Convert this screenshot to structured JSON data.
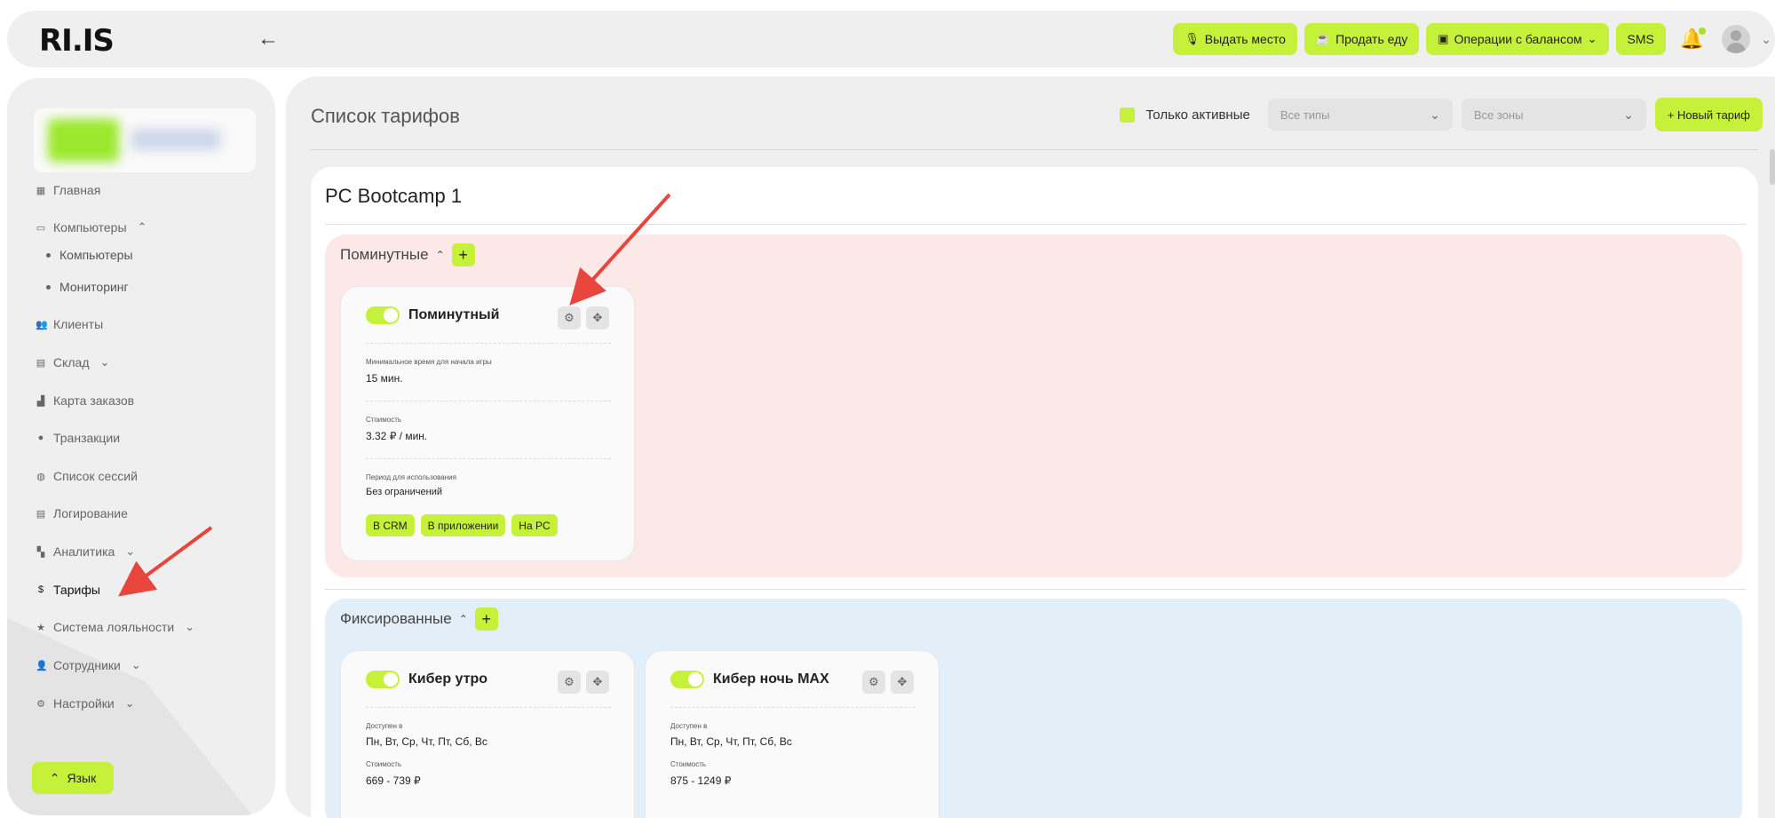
{
  "topbar": {
    "logo": "RI.IS",
    "actions": {
      "give_seat": "Выдать место",
      "sell_food": "Продать еду",
      "balance_ops": "Операции с балансом",
      "sms": "SMS"
    }
  },
  "sidebar": {
    "items": {
      "home": "Главная",
      "computers": "Компьютеры",
      "computers_sub": "Компьютеры",
      "monitoring": "Мониторинг",
      "clients": "Клиенты",
      "warehouse": "Склад",
      "orders_map": "Карта заказов",
      "transactions": "Транзакции",
      "sessions": "Список сессий",
      "logging": "Логирование",
      "analytics": "Аналитика",
      "tariffs": "Тарифы",
      "loyalty": "Система лояльности",
      "employees": "Сотрудники",
      "settings": "Настройки"
    },
    "language_button": "Язык"
  },
  "main": {
    "title": "Список тарифов",
    "only_active_label": "Только активные",
    "type_select_placeholder": "Все типы",
    "zone_select_placeholder": "Все зоны",
    "new_tariff_button": "+ Новый тариф"
  },
  "zone": {
    "name": "PC Bootcamp 1",
    "groups": {
      "per_minute": {
        "label": "Поминутные",
        "card": {
          "name": "Поминутный",
          "min_time_label": "Минимальное время для начала игры",
          "min_time_value": "15 мин.",
          "cost_label": "Стоимость",
          "cost_value": "3.32 ₽ / мин.",
          "period_label": "Период для использования",
          "period_value": "Без ограничений",
          "badges": [
            "В CRM",
            "В приложении",
            "На PC"
          ]
        }
      },
      "fixed": {
        "label": "Фиксированные",
        "cards": [
          {
            "name": "Кибер утро",
            "available_label": "Доступен в",
            "available_value": "Пн, Вт, Ср, Чт, Пт, Сб, Вс",
            "cost_label": "Стоимость",
            "cost_value": "669 - 739 ₽"
          },
          {
            "name": "Кибер ночь MAX",
            "available_label": "Доступен в",
            "available_value": "Пн, Вт, Ср, Чт, Пт, Сб, Вс",
            "cost_label": "Стоимость",
            "cost_value": "875 - 1249 ₽"
          }
        ]
      }
    }
  },
  "icons": {
    "settings": "gear-icon",
    "move": "move-icon",
    "notifications": "bell-icon",
    "back": "arrow-left-icon"
  },
  "colors": {
    "accent": "#c6f13a",
    "per_minute_bg": "#fde8e8",
    "fixed_bg": "#e2eff9",
    "arrow": "#e8453c"
  }
}
